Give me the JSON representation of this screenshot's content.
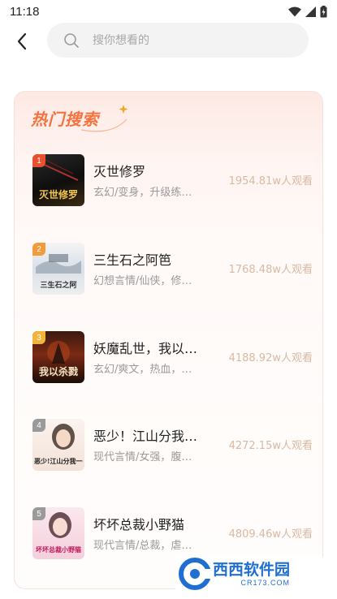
{
  "status_bar": {
    "time": "11:18",
    "icons": [
      "wifi-icon",
      "signal-icon",
      "battery-icon"
    ]
  },
  "header": {
    "back_icon": "back-arrow-icon",
    "search_icon": "search-icon",
    "search_placeholder": "搜你想看的",
    "search_value": ""
  },
  "hot_search": {
    "title": "热门搜索",
    "title_color": "#f5713d",
    "items": [
      {
        "rank": "1",
        "title": "灭世修罗",
        "tags": "玄幻/变身，升级练…",
        "views": "1954.81w人观看",
        "cover_text": "灭世修罗",
        "badge_color": "#e8502f"
      },
      {
        "rank": "2",
        "title": "三生石之阿笆",
        "tags": "幻想言情/仙侠，修…",
        "views": "1768.48w人观看",
        "cover_text": "三生石之阿",
        "badge_color": "#f29b3a"
      },
      {
        "rank": "3",
        "title": "妖魔乱世，我以…",
        "tags": "玄幻/爽文，热血，…",
        "views": "4188.92w人观看",
        "cover_text": "我以杀戮",
        "badge_color": "#f2b53a"
      },
      {
        "rank": "4",
        "title": "恶少！江山分我…",
        "tags": "现代言情/女强，腹…",
        "views": "4272.15w人观看",
        "cover_text": "恶少!江山分我一半",
        "badge_color": "#9a9a9a"
      },
      {
        "rank": "5",
        "title": "坏坏总裁小野猫",
        "tags": "现代言情/总裁，虐…",
        "views": "4809.46w人观看",
        "cover_text": "坏坏总裁小野猫",
        "badge_color": "#9a9a9a"
      }
    ]
  },
  "watermark": {
    "brand": "西西软件园",
    "domain": "CR173.COM",
    "color": "#1e6fd1"
  }
}
